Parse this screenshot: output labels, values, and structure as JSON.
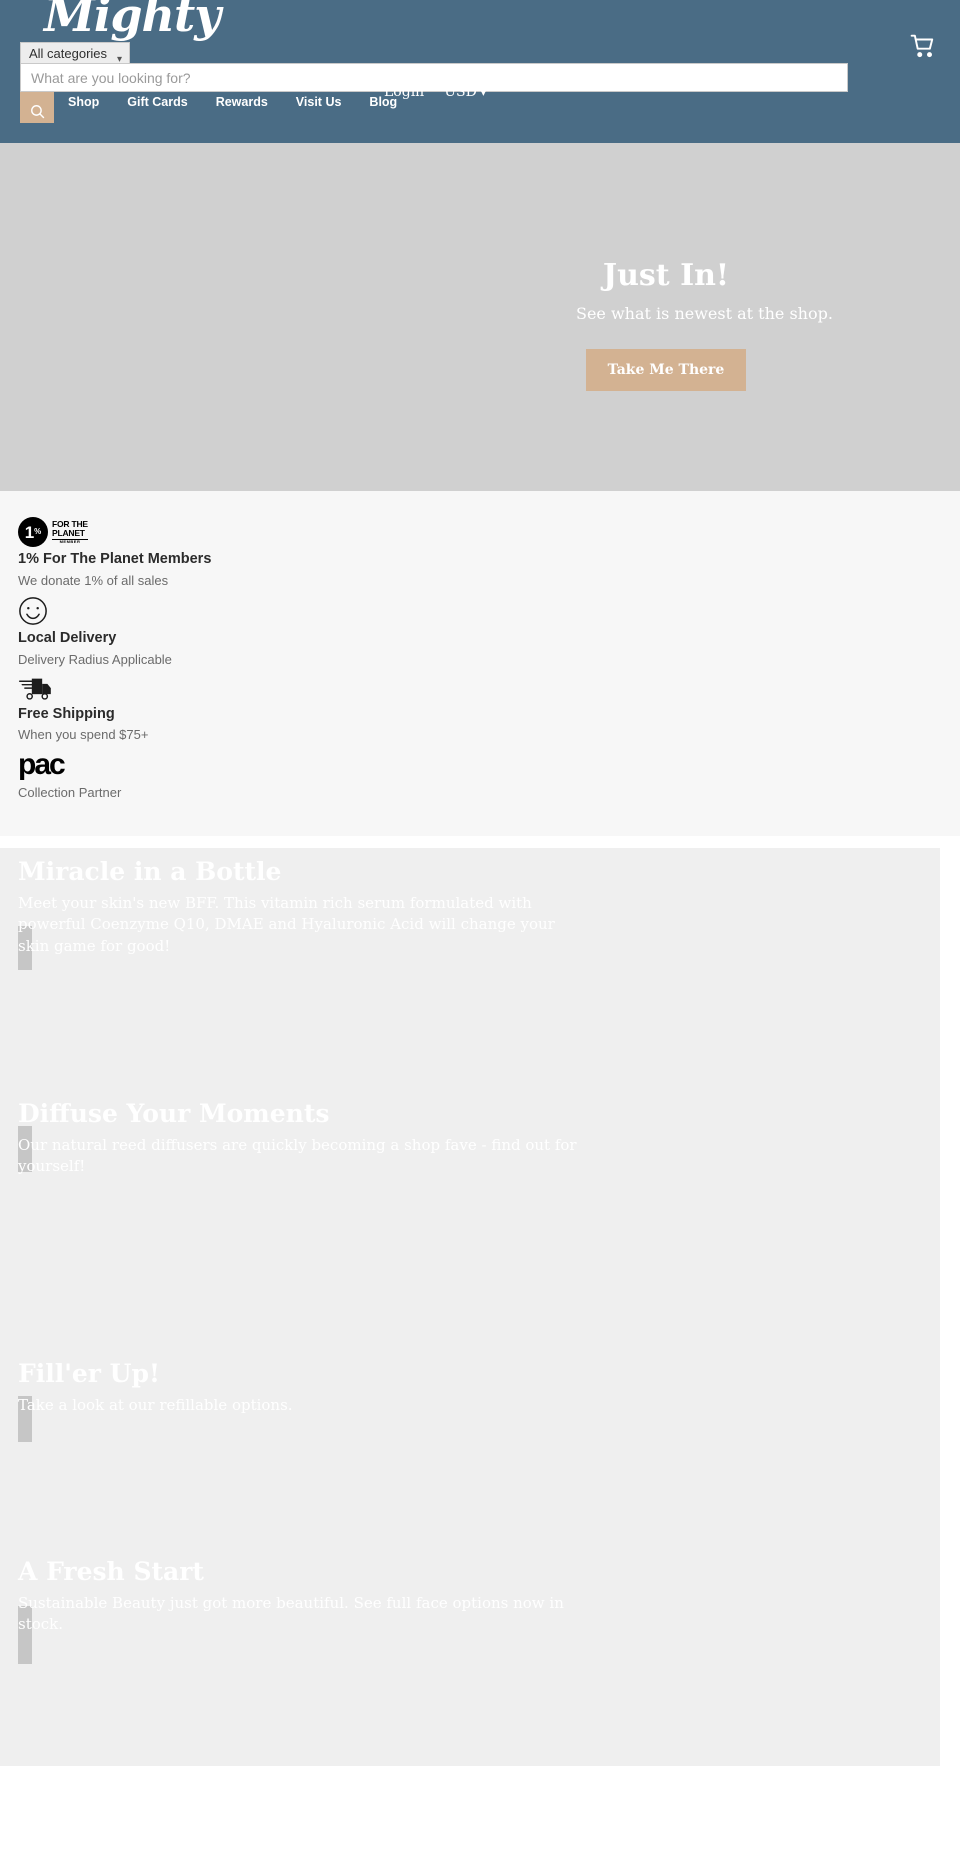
{
  "header": {
    "logo_text": "Mighty",
    "cart_icon": "shopping-cart-icon",
    "search": {
      "category_label": "All categories",
      "category_chevron": "chevron-down-icon",
      "placeholder": "What are you looking for?",
      "value": "",
      "submit_icon": "search-icon"
    },
    "nav": [
      {
        "label": "Shop"
      },
      {
        "label": "Gift Cards"
      },
      {
        "label": "Rewards"
      },
      {
        "label": "Visit Us"
      },
      {
        "label": "Blog"
      }
    ],
    "utility": {
      "login_label": "Login",
      "currency_label": "USD",
      "currency_chevron": "chevron-down-icon"
    },
    "background_color": "#4a6c85"
  },
  "hero": {
    "title": "Just In!",
    "subtitle": "See what is newest at the shop.",
    "cta_label": "Take Me There",
    "cta_color": "#d3b292",
    "background_color": "#d0d0d0"
  },
  "trust": {
    "background_color": "#f7f7f7",
    "items": [
      {
        "icon": "one-percent-for-the-planet-icon",
        "title": "1% For The Planet Members",
        "subtitle": "We donate 1% of all sales"
      },
      {
        "icon": "smiley-face-icon",
        "title": "Local Delivery",
        "subtitle": "Delivery Radius Applicable"
      },
      {
        "icon": "delivery-truck-icon",
        "title": "Free Shipping",
        "subtitle": "When you spend $75+"
      },
      {
        "icon": "pact-logo-icon",
        "title": "",
        "subtitle": "Collection Partner"
      }
    ],
    "badge_marks": {
      "one_digit": "1",
      "percent": "%",
      "for_the": "FOR THE",
      "planet": "PLANET",
      "member": "MEMBER",
      "pact_text": "pac"
    }
  },
  "features": [
    {
      "title": "Miracle in a Bottle",
      "body": "Meet your skin's new BFF. This vitamin rich serum formulated with powerful Coenzyme Q10, DMAE and Hyaluronic Acid will change your skin game for good!"
    },
    {
      "title": "Diffuse Your Moments",
      "body": "Our natural reed diffusers are quickly becoming a shop fave - find out for yourself!"
    },
    {
      "title": "Fill'er Up!",
      "body": "Take a look at our refillable options."
    },
    {
      "title": "A Fresh Start",
      "body": "Sustainable Beauty just got more beautiful. See full face options now in stock."
    }
  ]
}
